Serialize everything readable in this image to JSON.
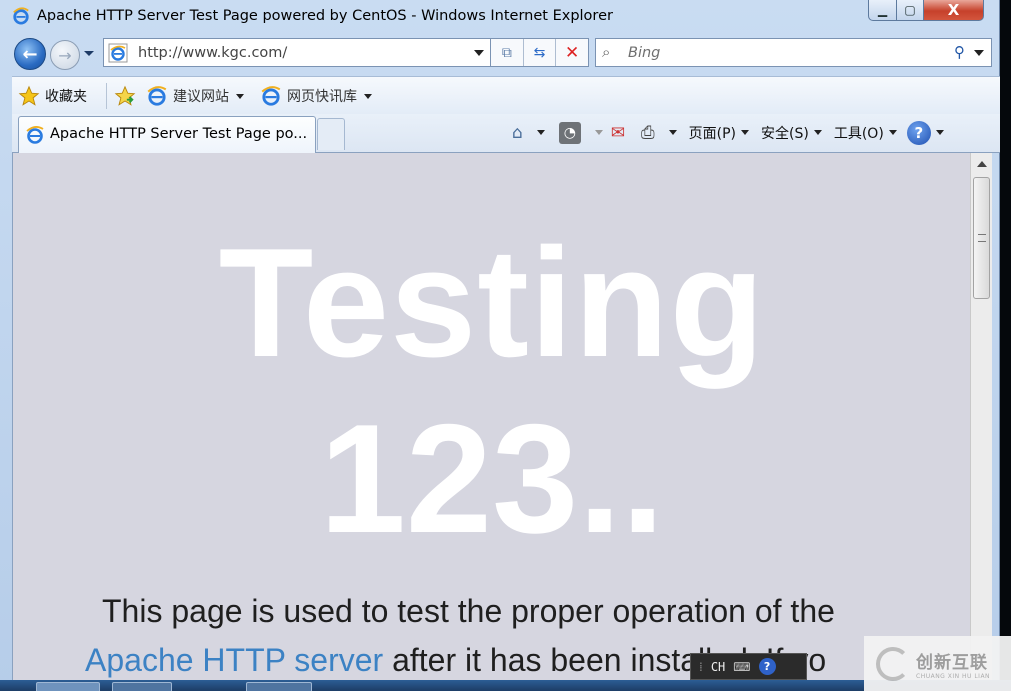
{
  "window": {
    "title": "Apache HTTP Server Test Page powered by CentOS - Windows Internet Explorer",
    "controls": {
      "minimize": "▁",
      "maximize": "▢",
      "close": "X"
    }
  },
  "navigation": {
    "back_icon": "back-arrow-icon",
    "forward_icon": "forward-arrow-icon",
    "address": "http://www.kgc.com/",
    "search_placeholder": "Bing"
  },
  "favorites_bar": {
    "favorites": "收藏夹",
    "suggested_sites": "建议网站",
    "web_slice_gallery": "网页快讯库"
  },
  "tabs": [
    {
      "label": "Apache HTTP Server Test Page po...",
      "active": true
    }
  ],
  "command_bar": {
    "page": "页面(P)",
    "safety": "安全(S)",
    "tools": "工具(O)",
    "help": "?"
  },
  "content": {
    "heading_line1": "Testing",
    "heading_line2": "123..",
    "para_line1": "This page is used to test the proper operation of the",
    "para_link": "Apache HTTP server",
    "para_line2_rest": " after it has been installed. If yo"
  },
  "ime": {
    "lang": "CH",
    "help": "?"
  },
  "watermark": {
    "brand_cn": "创新互联",
    "brand_en": "CHUANG XIN HU LIAN"
  },
  "colors": {
    "content_bg": "#d6d6e0",
    "link": "#3c82c4",
    "close_red": "#c6412b"
  }
}
